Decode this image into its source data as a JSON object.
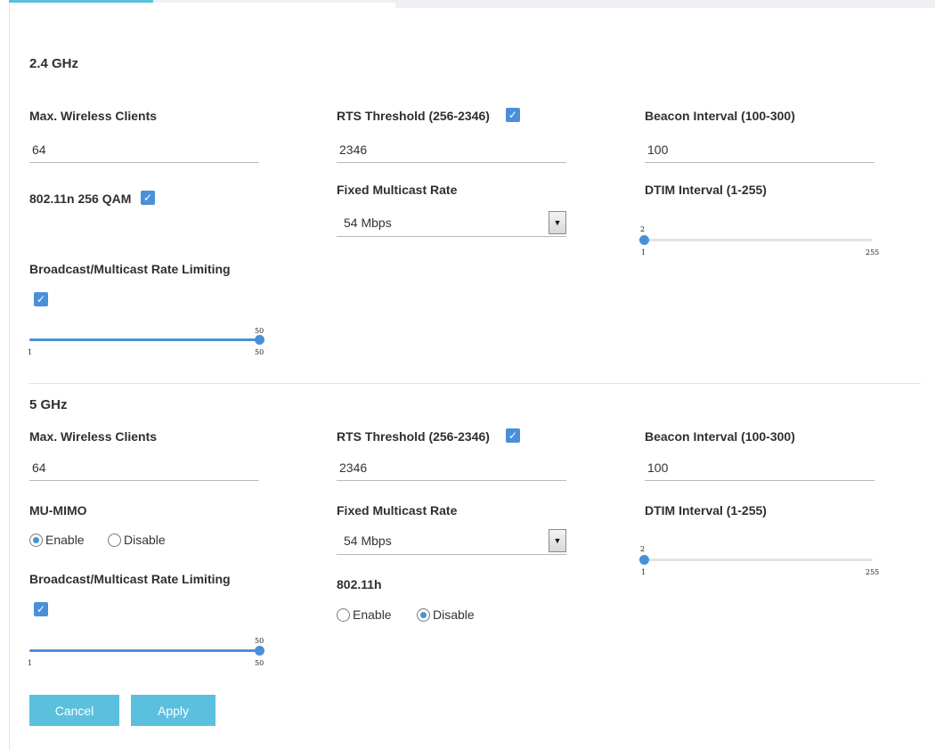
{
  "band24": {
    "title": "2.4 GHz",
    "max_clients": {
      "label": "Max. Wireless Clients",
      "value": "64"
    },
    "rts": {
      "label": "RTS Threshold (256-2346)",
      "value": "2346",
      "checked": true
    },
    "beacon": {
      "label": "Beacon Interval (100-300)",
      "value": "100"
    },
    "qam": {
      "label": "802.11n 256 QAM",
      "checked": true
    },
    "multicast_rate": {
      "label": "Fixed Multicast Rate",
      "value": "54 Mbps"
    },
    "dtim": {
      "label": "DTIM Interval (1-255)",
      "value": "2",
      "min": "1",
      "max": "255"
    },
    "rate_limit": {
      "label": "Broadcast/Multicast Rate Limiting",
      "checked": true,
      "value": "50",
      "min": "1",
      "max": "50"
    }
  },
  "band5": {
    "title": "5 GHz",
    "max_clients": {
      "label": "Max. Wireless Clients",
      "value": "64"
    },
    "rts": {
      "label": "RTS Threshold (256-2346)",
      "value": "2346",
      "checked": true
    },
    "beacon": {
      "label": "Beacon Interval (100-300)",
      "value": "100"
    },
    "mu_mimo": {
      "label": "MU-MIMO",
      "enable": "Enable",
      "disable": "Disable",
      "selected": "Enable"
    },
    "multicast_rate": {
      "label": "Fixed Multicast Rate",
      "value": "54 Mbps"
    },
    "dtim": {
      "label": "DTIM Interval (1-255)",
      "value": "2",
      "min": "1",
      "max": "255"
    },
    "rate_limit": {
      "label": "Broadcast/Multicast Rate Limiting",
      "checked": true,
      "value": "50",
      "min": "1",
      "max": "50"
    },
    "h80211": {
      "label": "802.11h",
      "enable": "Enable",
      "disable": "Disable",
      "selected": "Disable"
    }
  },
  "buttons": {
    "cancel": "Cancel",
    "apply": "Apply"
  },
  "colors": {
    "accent": "#4a90d9",
    "button": "#5bc0de"
  }
}
